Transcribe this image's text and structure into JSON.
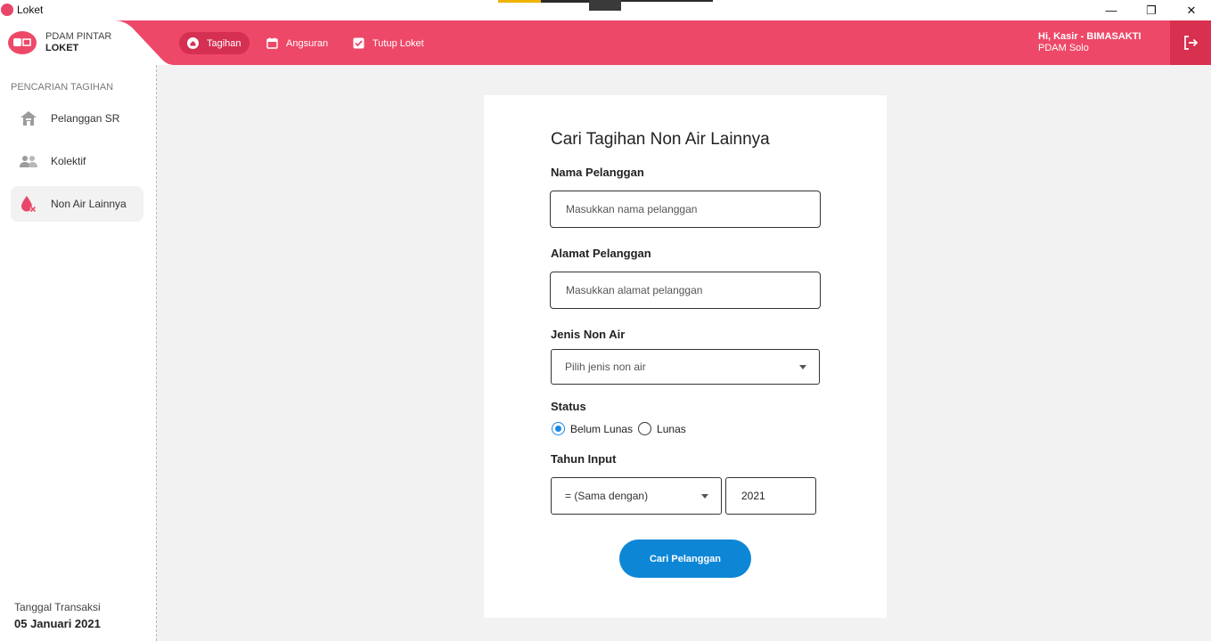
{
  "window": {
    "title": "Loket",
    "minimize_glyph": "—",
    "maximize_glyph": "❐",
    "close_glyph": "✕"
  },
  "brand": {
    "line1": "PDAM PINTAR",
    "line2": "LOKET"
  },
  "nav": {
    "items": [
      {
        "label": "Tagihan",
        "icon": "home-icon",
        "active": true
      },
      {
        "label": "Angsuran",
        "icon": "calendar-icon",
        "active": false
      },
      {
        "label": "Tutup Loket",
        "icon": "checkbox-icon",
        "active": false
      }
    ]
  },
  "user": {
    "greeting": "Hi, Kasir - BIMASAKTI",
    "org": "PDAM Solo"
  },
  "sidebar": {
    "section_title": "PENCARIAN TAGIHAN",
    "items": [
      {
        "label": "Pelanggan SR",
        "icon": "house-icon",
        "active": false
      },
      {
        "label": "Kolektif",
        "icon": "people-icon",
        "active": false
      },
      {
        "label": "Non Air Lainnya",
        "icon": "water-drop-icon",
        "active": true
      }
    ],
    "transaction_label": "Tanggal Transaksi",
    "transaction_date": "05 Januari 2021"
  },
  "form": {
    "title": "Cari Tagihan Non Air Lainnya",
    "name_label": "Nama Pelanggan",
    "name_placeholder": "Masukkan nama pelanggan",
    "address_label": "Alamat Pelanggan",
    "address_placeholder": "Masukkan alamat pelanggan",
    "type_label": "Jenis Non Air",
    "type_placeholder": "Pilih jenis non air",
    "status_label": "Status",
    "status_options": [
      {
        "label": "Belum Lunas",
        "checked": true
      },
      {
        "label": "Lunas",
        "checked": false
      }
    ],
    "year_label": "Tahun Input",
    "year_operator": "= (Sama dengan)",
    "year_value": "2021",
    "submit_label": "Cari Pelanggan"
  },
  "colors": {
    "header": "#ee4868",
    "accent_button": "#0d86d6",
    "radio_checked": "#1e88e5"
  }
}
